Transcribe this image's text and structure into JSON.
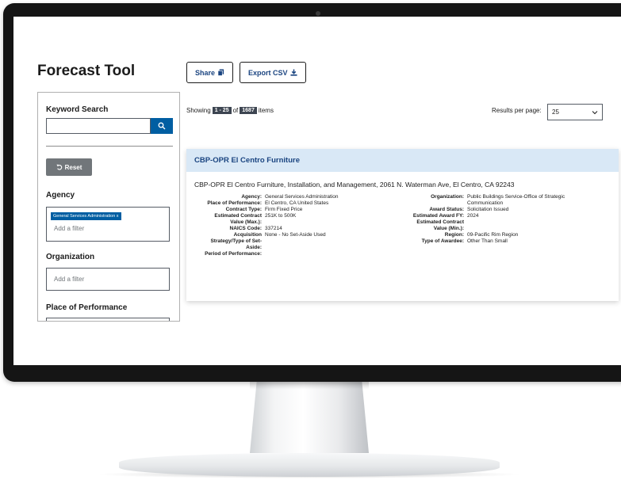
{
  "page": {
    "title": "Forecast Tool",
    "share_label": "Share",
    "export_label": "Export CSV"
  },
  "filters": {
    "keyword_heading": "Keyword Search",
    "keyword_value": "",
    "reset_label": "Reset",
    "agency_heading": "Agency",
    "agency_chip": "General Services Administration  x",
    "agency_placeholder": "Add a filter",
    "organization_heading": "Organization",
    "organization_placeholder": "Add a filter",
    "place_heading": "Place of Performance"
  },
  "results": {
    "showing_prefix": "Showing",
    "range": "1 - 25",
    "of": "of",
    "total": "1687",
    "items": "items",
    "per_page_label": "Results per page:",
    "per_page_value": "25"
  },
  "card": {
    "title": "CBP-OPR El Centro Furniture",
    "description": "CBP-OPR El Centro Furniture, Installation, and Management, 2061 N. Waterman Ave, El Centro, CA 92243",
    "left": [
      {
        "label": "Agency:",
        "value": "General Services Administration"
      },
      {
        "label": "",
        "value": ""
      },
      {
        "label": "Place of Performance:",
        "value": "El Centro, CA United States"
      },
      {
        "label": "Contract Type:",
        "value": "Firm Fixed Price"
      },
      {
        "label": "Estimated Contract",
        "value": "251K to 500K"
      },
      {
        "label": "Value (Max.):",
        "value": ""
      },
      {
        "label": "NAICS Code:",
        "value": "337214"
      },
      {
        "label": "Acquisition",
        "value": "None - No Set-Aside Used"
      },
      {
        "label": "Strategy/Type of Set-",
        "value": ""
      },
      {
        "label": "Aside:",
        "value": ""
      },
      {
        "label": "Period of Performance:",
        "value": ""
      }
    ],
    "right": [
      {
        "label": "Organization:",
        "value": "Public Buildings Service-Office of Strategic"
      },
      {
        "label": "",
        "value": "Communication"
      },
      {
        "label": "Award Status:",
        "value": "Solicitation Issued"
      },
      {
        "label": "Estimated Award FY:",
        "value": "2024"
      },
      {
        "label": "Estimated Contract",
        "value": ""
      },
      {
        "label": "Value (Min.):",
        "value": ""
      },
      {
        "label": "Region:",
        "value": "09-Pacific Rim Region"
      },
      {
        "label": "Type of Awardee:",
        "value": "Other Than Small"
      }
    ]
  },
  "colors": {
    "primary": "#005ea2",
    "dark_blue": "#1a4480",
    "card_header": "#d9e8f6",
    "reset_gray": "#71767a",
    "bezel": "#151515"
  },
  "icons": [
    "copy-icon",
    "download-icon",
    "search-icon",
    "undo-icon",
    "chevron-down-icon"
  ]
}
